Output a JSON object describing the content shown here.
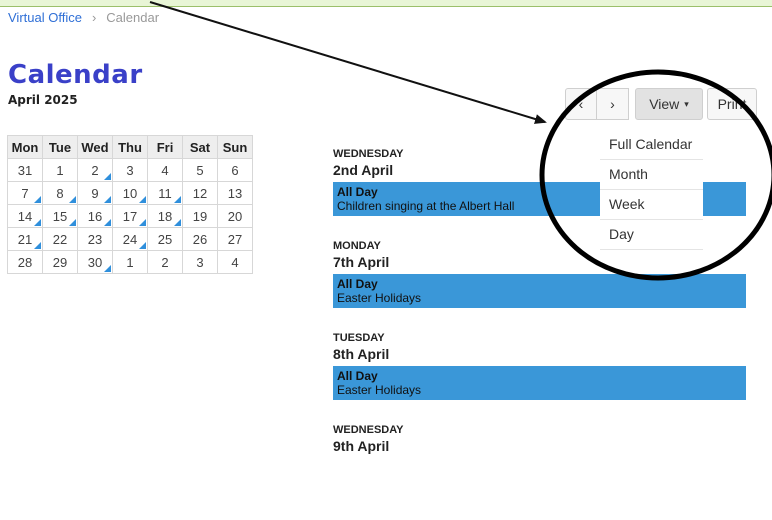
{
  "breadcrumb": {
    "home": "Virtual Office",
    "separator": "›",
    "current": "Calendar"
  },
  "page": {
    "title": "Calendar",
    "subtitle": "April 2025"
  },
  "mini_calendar": {
    "headers": [
      "Mon",
      "Tue",
      "Wed",
      "Thu",
      "Fri",
      "Sat",
      "Sun"
    ],
    "weeks": [
      [
        "31",
        "1",
        "2",
        "3",
        "4",
        "5",
        "6"
      ],
      [
        "7",
        "8",
        "9",
        "10",
        "11",
        "12",
        "13"
      ],
      [
        "14",
        "15",
        "16",
        "17",
        "18",
        "19",
        "20"
      ],
      [
        "21",
        "22",
        "23",
        "24",
        "25",
        "26",
        "27"
      ],
      [
        "28",
        "29",
        "30",
        "1",
        "2",
        "3",
        "4"
      ]
    ],
    "event_markers": [
      [
        false,
        false,
        true,
        false,
        false,
        false,
        false
      ],
      [
        true,
        true,
        true,
        true,
        true,
        false,
        false
      ],
      [
        true,
        true,
        true,
        true,
        true,
        false,
        false
      ],
      [
        true,
        false,
        false,
        true,
        false,
        false,
        false
      ],
      [
        false,
        false,
        true,
        false,
        false,
        false,
        false
      ]
    ]
  },
  "agenda": [
    {
      "day": "WEDNESDAY",
      "date": "2nd April",
      "time": "All Day",
      "title": "Children singing at the Albert Hall"
    },
    {
      "day": "MONDAY",
      "date": "7th April",
      "time": "All Day",
      "title": "Easter Holidays"
    },
    {
      "day": "TUESDAY",
      "date": "8th April",
      "time": "All Day",
      "title": "Easter Holidays"
    },
    {
      "day": "WEDNESDAY",
      "date": "9th April",
      "time": "",
      "title": ""
    }
  ],
  "toolbar": {
    "prev": "‹",
    "next": "›",
    "view": "View",
    "view_caret": "▾",
    "print": "Print"
  },
  "view_menu": [
    "Full Calendar",
    "Month",
    "Week",
    "Day"
  ],
  "colors": {
    "event": "#3a97d8",
    "title": "#3a40c8",
    "link": "#2f6fd6"
  }
}
